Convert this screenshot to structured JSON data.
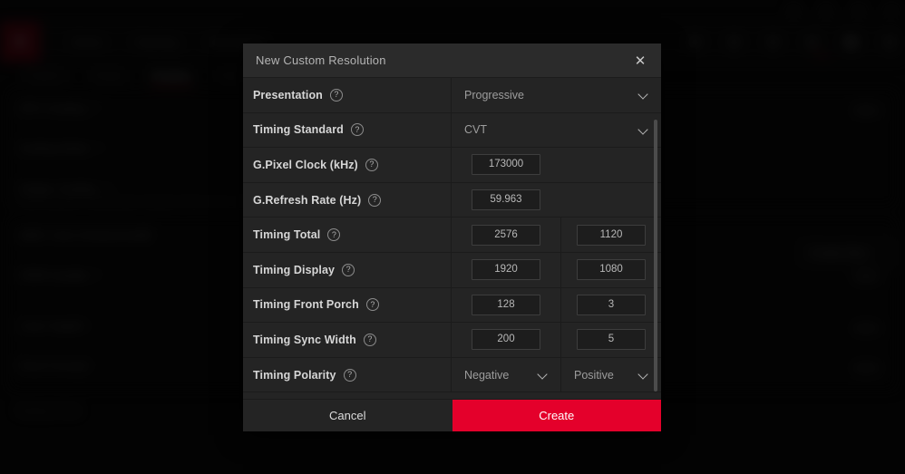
{
  "background": {
    "logo": "A",
    "nav_items": [
      "Home",
      "Gaming",
      "Streaming"
    ],
    "sub_tabs": [
      "Graphics",
      "Display",
      "Display",
      "Audio"
    ],
    "top_icons": [
      "search-icon",
      "user-icon",
      "alert-icon",
      "notification-icon",
      "gear-icon",
      "menu-icon"
    ],
    "gear_label": "NEW",
    "rows": [
      {
        "label": "GPU Scaling",
        "sub": ""
      },
      {
        "label": "Scaling Mode",
        "sub": ""
      },
      {
        "label": "Integer Scaling",
        "sub": "Scale up games using integer multiples of the source resolution"
      },
      {
        "label": "AMD Color Enhancement",
        "sub": ""
      },
      {
        "label": "HDMI Quality",
        "sub": ""
      },
      {
        "label": "Color Depth",
        "sub": ""
      },
      {
        "label": "Pixel Format",
        "sub": ""
      }
    ],
    "create_button": "Create New",
    "footer_link": "Display Color"
  },
  "dialog": {
    "title": "New Custom Resolution",
    "close_icon": "close-icon",
    "rows": [
      {
        "label": "Presentation",
        "type": "select",
        "value": "Progressive"
      },
      {
        "label": "Timing Standard",
        "type": "select",
        "value": "CVT"
      },
      {
        "label": "G.Pixel Clock (kHz)",
        "type": "input-single",
        "value": "173000"
      },
      {
        "label": "G.Refresh Rate (Hz)",
        "type": "input-single",
        "value": "59.963"
      },
      {
        "label": "Timing Total",
        "type": "input-pair",
        "value": "2576",
        "value2": "1120"
      },
      {
        "label": "Timing Display",
        "type": "input-pair",
        "value": "1920",
        "value2": "1080"
      },
      {
        "label": "Timing Front Porch",
        "type": "input-pair",
        "value": "128",
        "value2": "3"
      },
      {
        "label": "Timing Sync Width",
        "type": "input-pair",
        "value": "200",
        "value2": "5"
      },
      {
        "label": "Timing Polarity",
        "type": "select-pair",
        "value": "Negative",
        "value2": "Positive"
      }
    ],
    "help_glyph": "?",
    "cancel_label": "Cancel",
    "create_label": "Create"
  },
  "colors": {
    "accent_red": "#e4002b",
    "dialog_bg": "#242424",
    "header_bg": "#2b2b2b",
    "app_bg": "#070707"
  }
}
